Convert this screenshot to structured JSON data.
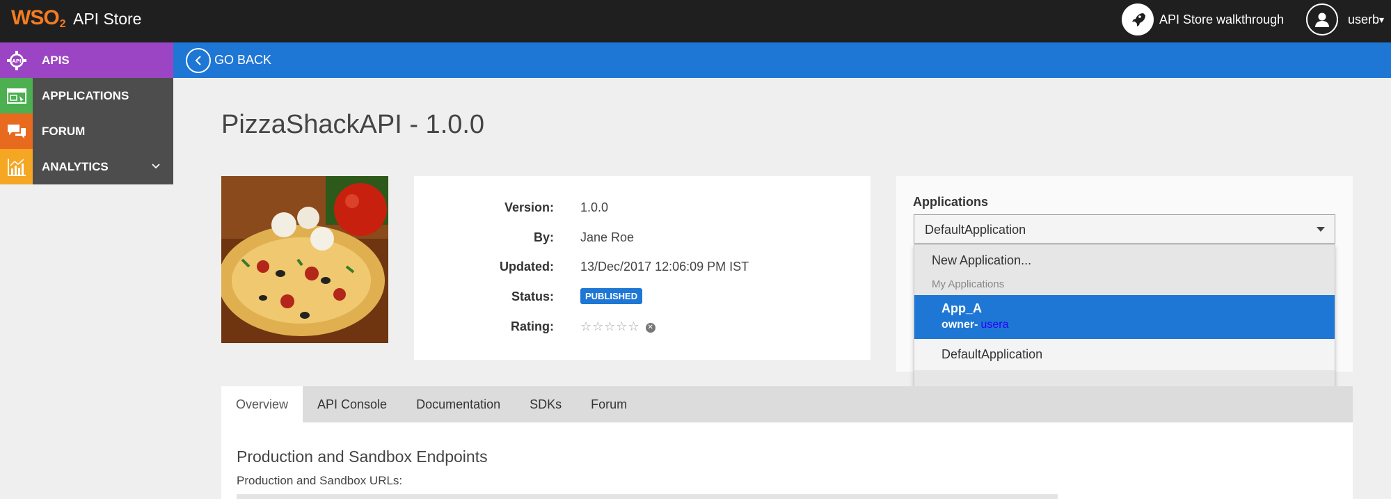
{
  "header": {
    "logo_text": "WSO",
    "logo_sub": "2",
    "app_title": "API Store",
    "walkthrough_label": "API Store walkthrough",
    "user_name": "userb",
    "user_caret": "▾"
  },
  "nav": {
    "items": [
      {
        "label": "APIS",
        "icon": "apis-gear-icon",
        "color": "#9b45c4"
      },
      {
        "label": "APPLICATIONS",
        "icon": "applications-window-icon",
        "color": "#4caf50"
      },
      {
        "label": "FORUM",
        "icon": "forum-chat-icon",
        "color": "#e86a1f"
      },
      {
        "label": "ANALYTICS",
        "icon": "analytics-chart-icon",
        "color": "#f5a623"
      }
    ]
  },
  "backbar": {
    "label": "GO BACK"
  },
  "api": {
    "title": "PizzaShackAPI - 1.0.0",
    "fields": {
      "version_label": "Version:",
      "version": "1.0.0",
      "by_label": "By:",
      "by": "Jane Roe",
      "updated_label": "Updated:",
      "updated": "13/Dec/2017 12:06:09 PM IST",
      "status_label": "Status:",
      "status": "PUBLISHED",
      "rating_label": "Rating:",
      "rating_stars": "☆☆☆☆☆",
      "rating_value": 0
    }
  },
  "applications": {
    "label": "Applications",
    "selected": "DefaultApplication",
    "dropdown": {
      "new_option": "New Application...",
      "group_label": "My Applications",
      "highlighted": {
        "name": "App_A",
        "owner_prefix": "owner-",
        "owner": "usera"
      },
      "other": "DefaultApplication"
    }
  },
  "tabs": [
    {
      "label": "Overview",
      "active": true
    },
    {
      "label": "API Console",
      "active": false
    },
    {
      "label": "Documentation",
      "active": false
    },
    {
      "label": "SDKs",
      "active": false
    },
    {
      "label": "Forum",
      "active": false
    }
  ],
  "content": {
    "section_title": "Production and Sandbox Endpoints",
    "section_sub": "Production and Sandbox URLs:"
  },
  "colors": {
    "topbar": "#1f1f1f",
    "accent_blue": "#1e77d4",
    "nav_active": "#9b45c4",
    "logo_orange": "#f47c20"
  }
}
